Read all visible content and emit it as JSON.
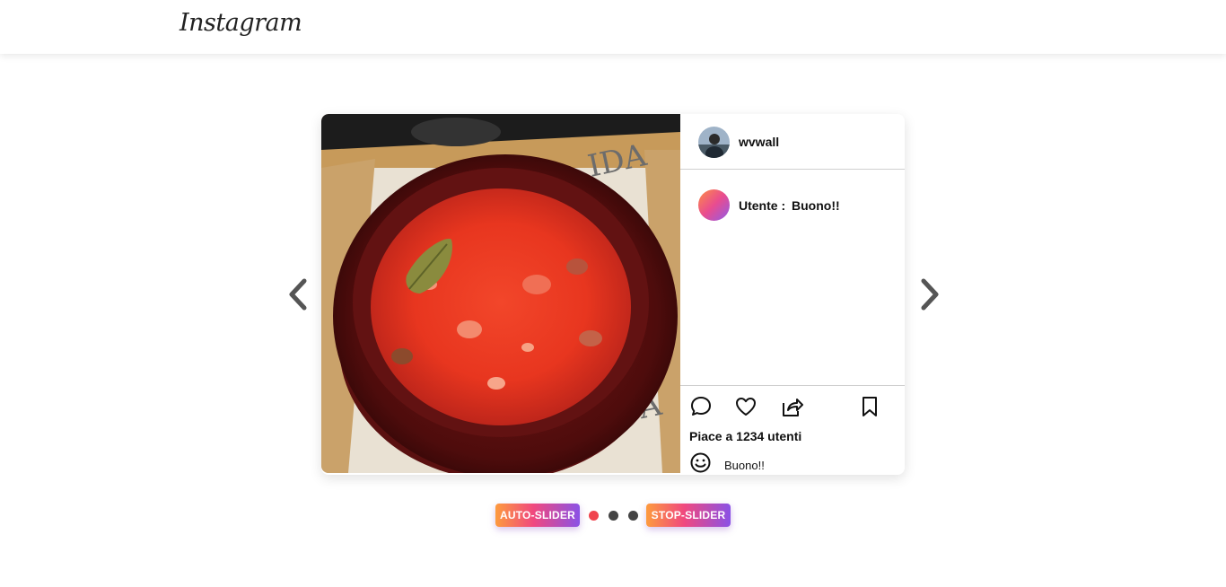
{
  "header": {
    "logo_text": "Instagram"
  },
  "nav": {
    "prev_icon": "chevron-left-icon",
    "next_icon": "chevron-right-icon"
  },
  "post": {
    "username": "wvwall",
    "comment": {
      "user_label": "Utente :",
      "text": "Buono!!"
    },
    "likes_text": "Piace a 1234 utenti",
    "comment_input_value": "Buono!!",
    "icons": [
      "comment-icon",
      "heart-icon",
      "share-icon",
      "bookmark-icon",
      "smiley-icon"
    ]
  },
  "controls": {
    "auto_label": "AUTO-SLIDER",
    "stop_label": "STOP-SLIDER",
    "dots": [
      {
        "active": true,
        "color": "#f0444e"
      },
      {
        "active": false,
        "color": "#444444"
      },
      {
        "active": false,
        "color": "#444444"
      }
    ]
  },
  "colors": {
    "accent_gradient": [
      "#fd9b3e",
      "#f0487f",
      "#8a52e6"
    ],
    "active_dot": "#f0444e"
  }
}
